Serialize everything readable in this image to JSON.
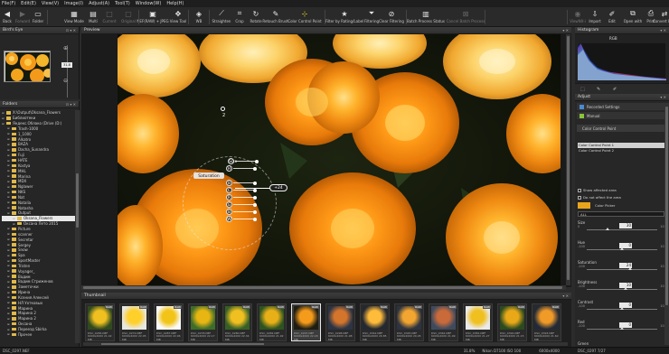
{
  "menu": [
    "File(F)",
    "Edit(E)",
    "View(V)",
    "Image(I)",
    "Adjust(A)",
    "Tool(T)",
    "Window(W)",
    "Help(H)"
  ],
  "toolbar": [
    {
      "label": "Back",
      "icon": "back-arrow-icon",
      "dim": false
    },
    {
      "label": "Forward",
      "icon": "forward-arrow-icon",
      "dim": true
    },
    {
      "label": "Folder",
      "icon": "folder-icon",
      "dim": false
    },
    {
      "label": "View Mode",
      "icon": "view-mode-icon",
      "dim": false
    },
    {
      "label": "Multi",
      "icon": "multi-icon",
      "dim": false
    },
    {
      "label": "Current",
      "icon": "current-icon",
      "dim": true
    },
    {
      "label": "Original",
      "icon": "original-icon",
      "dim": true
    },
    {
      "label": "NEF(RAW) + JPEG",
      "icon": "nef-jpeg-icon",
      "dim": false
    },
    {
      "label": "View Tool",
      "icon": "view-tool-icon",
      "dim": false
    },
    {
      "label": "WB",
      "icon": "white-balance-icon",
      "dim": false
    },
    {
      "label": "Straighten",
      "icon": "straighten-icon",
      "dim": false
    },
    {
      "label": "Crop",
      "icon": "crop-icon",
      "dim": false
    },
    {
      "label": "Rotate",
      "icon": "rotate-icon",
      "dim": false
    },
    {
      "label": "Retouch Brush",
      "icon": "retouch-brush-icon",
      "dim": false
    },
    {
      "label": "Color Control Point",
      "icon": "color-control-point-icon",
      "dim": false
    },
    {
      "label": "Filter by Rating/Label",
      "icon": "star-filter-icon",
      "dim": false
    },
    {
      "label": "Filtering",
      "icon": "filter-icon",
      "dim": false
    },
    {
      "label": "Clear Filtering",
      "icon": "clear-filter-icon",
      "dim": false
    },
    {
      "label": "Batch Process Status",
      "icon": "batch-status-icon",
      "dim": false
    },
    {
      "label": "Cancel Batch Process",
      "icon": "cancel-batch-icon",
      "dim": true
    },
    {
      "label": "ViewNX-i",
      "icon": "viewnx-icon",
      "dim": true
    },
    {
      "label": "Import",
      "icon": "import-icon",
      "dim": false
    },
    {
      "label": "Edit",
      "icon": "edit-icon",
      "dim": false
    },
    {
      "label": "Open with",
      "icon": "open-with-icon",
      "dim": false
    },
    {
      "label": "Print",
      "icon": "print-icon",
      "dim": false
    },
    {
      "label": "Convert Files",
      "icon": "convert-files-icon",
      "dim": false
    }
  ],
  "birdseye": {
    "title": "Bird's Eye",
    "zoom": "31.8"
  },
  "folders": {
    "title": "Folders",
    "rows": [
      {
        "label": "X:\\Output\\Oksana_Flowers",
        "level": 0
      },
      {
        "label": "Библиотеки",
        "level": 0
      },
      {
        "label": "Яндекс.Облако (Drive (D:)",
        "level": 0
      },
      {
        "label": "Trash-1000",
        "level": 1
      },
      {
        "label": "1_1000",
        "level": 1
      },
      {
        "label": "Alkatro",
        "level": 1
      },
      {
        "label": "BAZA",
        "level": 1
      },
      {
        "label": "Dacha_Sunandra",
        "level": 1
      },
      {
        "label": "Fuji",
        "level": 1
      },
      {
        "label": "HATE",
        "level": 1
      },
      {
        "label": "Kostya",
        "level": 1
      },
      {
        "label": "MHL",
        "level": 1
      },
      {
        "label": "Marina",
        "level": 1
      },
      {
        "label": "MDX",
        "level": 1
      },
      {
        "label": "Nglawer",
        "level": 1
      },
      {
        "label": "NKS",
        "level": 1
      },
      {
        "label": "Nat",
        "level": 1
      },
      {
        "label": "Natalia",
        "level": 1
      },
      {
        "label": "Natasha",
        "level": 1
      },
      {
        "label": "Output",
        "level": 1
      },
      {
        "label": "Oksana_Flowers",
        "level": 2,
        "selected": true
      },
      {
        "label": "Оксана Лето 2015",
        "level": 2
      },
      {
        "label": "Picture",
        "level": 1
      },
      {
        "label": "scanner",
        "level": 1
      },
      {
        "label": "Secretar",
        "level": 1
      },
      {
        "label": "Sergey",
        "level": 1
      },
      {
        "label": "Snow",
        "level": 1
      },
      {
        "label": "Spa",
        "level": 1
      },
      {
        "label": "SportMaster",
        "level": 1
      },
      {
        "label": "Tristen",
        "level": 1
      },
      {
        "label": "Voyager_",
        "level": 1
      },
      {
        "label": "Вадим",
        "level": 1
      },
      {
        "label": "Вадим Стриженов",
        "level": 1
      },
      {
        "label": "Заметочки",
        "level": 1
      },
      {
        "label": "Ирина",
        "level": 1
      },
      {
        "label": "Ксения Алексей",
        "level": 1
      },
      {
        "label": "НЛ Уотковых",
        "level": 1
      },
      {
        "label": "Марина",
        "level": 1
      },
      {
        "label": "Марина 2",
        "level": 1
      },
      {
        "label": "Марина 2",
        "level": 1
      },
      {
        "label": "Оксана",
        "level": 1
      },
      {
        "label": "Переезд Sbirka",
        "level": 1
      },
      {
        "label": "Прочее",
        "level": 1
      }
    ]
  },
  "preview": {
    "title": "Preview",
    "point_number": "2"
  },
  "ccp": {
    "labels": [
      "Size",
      "H",
      "Saturation",
      "B",
      "C",
      "R",
      "G",
      "B",
      "W"
    ],
    "active": "Saturation",
    "value": "+24"
  },
  "thumbnail": {
    "title": "Thumbnail",
    "items": [
      {
        "name": "DSC_0265.NEF",
        "size": "6000x4000 21.42 MB",
        "tag": "RAW",
        "c1": "#f0c020",
        "c2": "#2f4a1f"
      },
      {
        "name": "DSC_0272.NEF",
        "size": "6000x4000 22.05 MB",
        "tag": "RAW",
        "c1": "#ffcf2a",
        "c2": "#e8e8e0"
      },
      {
        "name": "DSC_0287.NEF",
        "size": "6000x4000 22.06 MB",
        "tag": "RAW",
        "c1": "#f2c418",
        "c2": "#fafafa"
      },
      {
        "name": "DSC_0278.NEF",
        "size": "6000x4000 22.17 MB",
        "tag": "RAW",
        "c1": "#e7b612",
        "c2": "#3e6d2a"
      },
      {
        "name": "DSC_0280.NEF",
        "size": "6000x4000 22.34 MB",
        "tag": "RAW",
        "c1": "#f0c020",
        "c2": "#365f26"
      },
      {
        "name": "DSC_0282.NEF",
        "size": "6000x4000 21.92 MB",
        "tag": "RAW",
        "c1": "#e8b018",
        "c2": "#2c5320"
      },
      {
        "name": "DSC_0297.NEF",
        "size": "6000x4000 22.18 MB",
        "tag": "RAW",
        "c1": "#f59b1c",
        "c2": "#1d1d12"
      },
      {
        "name": "DSC_0298.NEF",
        "size": "6000x4000 21.98 MB",
        "tag": "RAW",
        "c1": "#d4752c",
        "c2": "#2b3446"
      },
      {
        "name": "DSC_0342.NEF",
        "size": "6000x4000 20.85 MB",
        "tag": "RAW",
        "c1": "#ffbb3a",
        "c2": "#232831"
      },
      {
        "name": "DSC_0345.NEF",
        "size": "6000x4000 20.45 MB",
        "tag": "RAW",
        "c1": "#f2a530",
        "c2": "#2d3340"
      },
      {
        "name": "DSC_0362.NEF",
        "size": "6000x4000 21.09 MB",
        "tag": "RAW",
        "c1": "#c96a3a",
        "c2": "#3d4a5e"
      },
      {
        "name": "DSC_0381.NEF",
        "size": "6000x4000 21.27 MB",
        "tag": "RAW",
        "c1": "#f0c020",
        "c2": "#eaeaea"
      },
      {
        "name": "DSC_0392.NEF",
        "size": "6000x4000 21.15 MB",
        "tag": "RAW",
        "c1": "#e8a818",
        "c2": "#2b4a1f"
      },
      {
        "name": "DSC_0393.NEF",
        "size": "6000x4000 21.60 MB",
        "tag": "RAW",
        "c1": "#f09a28",
        "c2": "#222a38"
      }
    ]
  },
  "status": {
    "filename": "DSC_0297.NEF",
    "zoom": "31.8%",
    "info": "Nikon D7100 ISO 100",
    "dims": "6000x4000",
    "right": "DSC_0297 7/27"
  },
  "histogram": {
    "title": "Histogram",
    "channel": "RGB"
  },
  "adjust": {
    "title": "Adjust",
    "recorded": "Recorded Settings",
    "manual": "Manual",
    "ccp_title": "Color Control Point",
    "points": [
      "Color Control Point 1",
      "Color Control Point 2"
    ],
    "show_area": "Show affected area",
    "not_affect": "Do not affect the area",
    "color_picker": "Color Picker",
    "mode": "ALL",
    "picker_color": "#e8a51c",
    "sliders": [
      {
        "name": "Size",
        "min": "0",
        "max": "100",
        "value": "30",
        "pos": 0.3
      },
      {
        "name": "Hue",
        "min": "-100",
        "max": "100",
        "value": "0",
        "pos": 0.5
      },
      {
        "name": "Saturation",
        "min": "-100",
        "max": "100",
        "value": "24",
        "pos": 0.62
      },
      {
        "name": "Brightness",
        "min": "-100",
        "max": "100",
        "value": "10",
        "pos": 0.55
      },
      {
        "name": "Contrast",
        "min": "-100",
        "max": "100",
        "value": "0",
        "pos": 0.5
      },
      {
        "name": "Red",
        "min": "-100",
        "max": "100",
        "value": "0",
        "pos": 0.5
      }
    ],
    "last_slider_label": "Green"
  }
}
